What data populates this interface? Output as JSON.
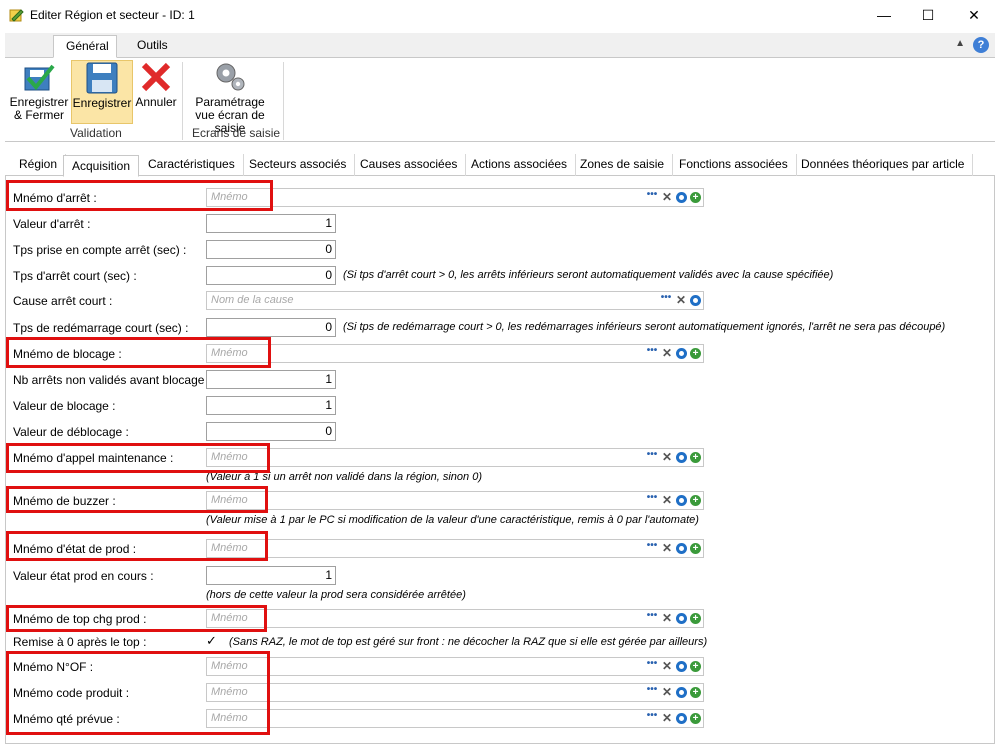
{
  "window": {
    "title": "Editer Région et secteur - ID: 1",
    "minimize": "—",
    "maximize": "☐",
    "close": "✕"
  },
  "ribbon": {
    "tabs": [
      "Général",
      "Outils"
    ],
    "buttons": {
      "save_close": "Enregistrer & Fermer",
      "save": "Enregistrer",
      "cancel": "Annuler",
      "param": "Paramétrage vue écran de saisie"
    },
    "groups": {
      "validation": "Validation",
      "ecrans": "Ecrans de saisie"
    },
    "help": "?"
  },
  "form_tabs": [
    "Région",
    "Acquisition",
    "Caractéristiques",
    "Secteurs associés",
    "Causes associées",
    "Actions associées",
    "Zones de saisie",
    "Fonctions associées",
    "Données théoriques par article"
  ],
  "fields": {
    "memo_arret": {
      "label": "Mnémo d'arrêt :",
      "placeholder": "Mnémo"
    },
    "valeur_arret": {
      "label": "Valeur d'arrêt :",
      "value": "1"
    },
    "tps_prise": {
      "label": "Tps prise en compte arrêt (sec) :",
      "value": "0"
    },
    "tps_court": {
      "label": "Tps d'arrêt court (sec) :",
      "value": "0",
      "hint": "(Si tps d'arrêt court > 0, les arrêts inférieurs seront automatiquement validés avec la cause spécifiée)"
    },
    "cause_court": {
      "label": "Cause arrêt court :",
      "placeholder": "Nom de la cause"
    },
    "tps_redem": {
      "label": "Tps de redémarrage court (sec) :",
      "value": "0",
      "hint": "(Si tps de redémarrage court > 0, les redémarrages inférieurs seront automatiquement ignorés, l'arrêt ne sera pas découpé)"
    },
    "memo_blocage": {
      "label": "Mnémo de blocage :",
      "placeholder": "Mnémo"
    },
    "nb_arrets": {
      "label": "Nb arrêts non validés avant blocage :",
      "value": "1"
    },
    "val_blocage": {
      "label": "Valeur de blocage :",
      "value": "1"
    },
    "val_deblocage": {
      "label": "Valeur de déblocage :",
      "value": "0"
    },
    "memo_appel": {
      "label": "Mnémo d'appel maintenance :",
      "placeholder": "Mnémo",
      "hint": "(Valeur à 1 si un arrêt non validé dans la région, sinon 0)"
    },
    "memo_buzzer": {
      "label": "Mnémo de buzzer :",
      "placeholder": "Mnémo",
      "hint": "(Valeur mise à 1 par le PC si modification de la valeur d'une caractéristique, remis à 0 par l'automate)"
    },
    "memo_etat": {
      "label": "Mnémo d'état de prod :",
      "placeholder": "Mnémo"
    },
    "val_etat": {
      "label": "Valeur état prod en cours :",
      "value": "1",
      "hint": "(hors de cette valeur la prod sera considérée arrêtée)"
    },
    "memo_top": {
      "label": "Mnémo de top chg prod :",
      "placeholder": "Mnémo"
    },
    "remise": {
      "label": "Remise à 0 après le top :",
      "check": "✓",
      "hint": "(Sans RAZ, le mot de top est géré sur front : ne décocher la RAZ que si elle est gérée par ailleurs)"
    },
    "memo_of": {
      "label": "Mnémo N°OF :",
      "placeholder": "Mnémo"
    },
    "memo_code": {
      "label": "Mnémo code produit :",
      "placeholder": "Mnémo"
    },
    "memo_qte": {
      "label": "Mnémo qté prévue :",
      "placeholder": "Mnémo"
    }
  },
  "icons": {
    "dots": "•••",
    "clear": "✕",
    "add": "+"
  }
}
